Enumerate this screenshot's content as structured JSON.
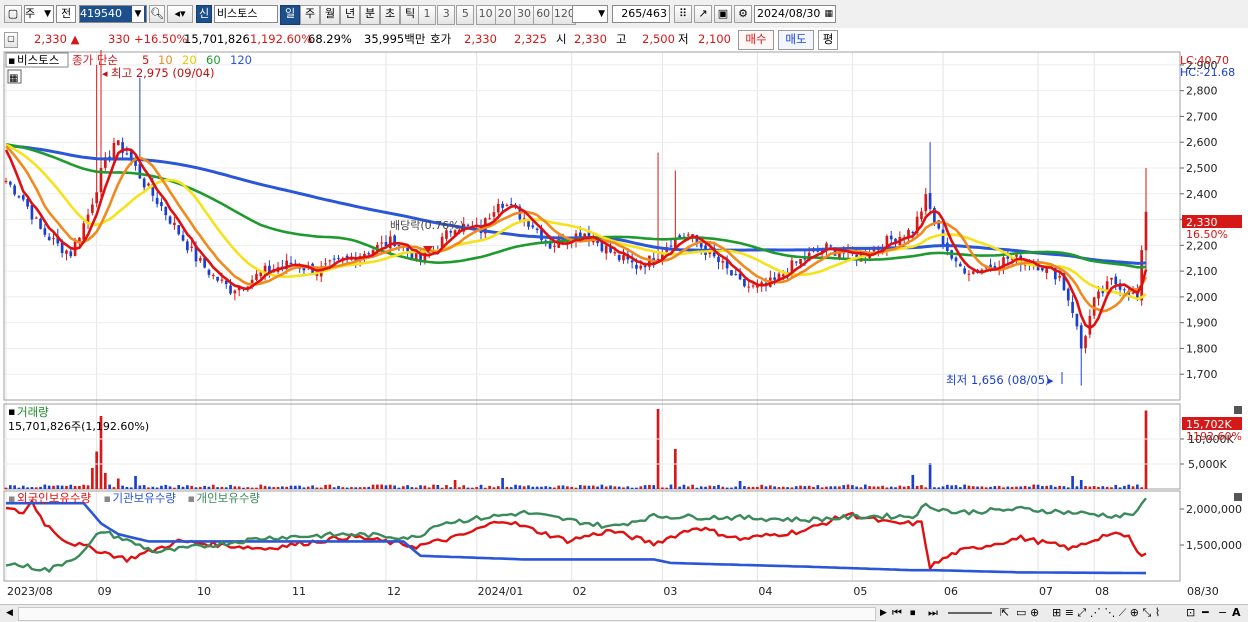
{
  "toolbar": {
    "period_type": "주",
    "prev_label": "전",
    "code": "419540",
    "badge": "신",
    "stock_name": "비스토스",
    "periods": [
      "일",
      "주",
      "월",
      "년",
      "분",
      "초",
      "틱"
    ],
    "intervals": [
      "1",
      "3",
      "5",
      "10",
      "20",
      "30",
      "60",
      "120"
    ],
    "count": "265",
    "total": "/463",
    "date": "2024/08/30"
  },
  "quote": {
    "price": "2,330",
    "change": "330",
    "change_pct": "+16.50%",
    "volume": "15,701,826",
    "volume_pct": "1,192.60%",
    "turnover": "68.29%",
    "amount": "35,995백만",
    "ask_label": "호가",
    "ask": "2,330",
    "bid": "2,325",
    "open_label": "시",
    "open": "2,330",
    "high_label": "고",
    "high": "2,500",
    "low_label": "저",
    "low": "2,100",
    "buy_label": "매수",
    "sell_label": "매도",
    "avg_label": "평"
  },
  "colors": {
    "up": "#d51818",
    "down": "#1a3fd0",
    "ma5": "#e01010",
    "ma10": "#f08a1e",
    "ma20": "#f5e21a",
    "ma60": "#1f9a2e",
    "ma120": "#2a56d8",
    "foreign": "#e01010",
    "institution": "#2a56d8",
    "individual": "#3a8a5a"
  },
  "chart_data": [
    {
      "type": "candlestick",
      "panel_title": "비스토스",
      "legend": [
        {
          "name": "종가 단순",
          "color": "#d51818"
        },
        {
          "name": "5",
          "color": "#e01010"
        },
        {
          "name": "10",
          "color": "#f08a1e"
        },
        {
          "name": "20",
          "color": "#e8c800"
        },
        {
          "name": "60",
          "color": "#1f9a2e"
        },
        {
          "name": "120",
          "color": "#2a56d8"
        }
      ],
      "y_ticks": [
        "2,900",
        "2,800",
        "2,700",
        "2,600",
        "2,500",
        "2,400",
        "2,300",
        "2,200",
        "2,100",
        "2,000",
        "1,900",
        "1,800",
        "1,700"
      ],
      "ylim": [
        1600,
        2950
      ],
      "x_ticks": [
        "2023/08",
        "09",
        "10",
        "11",
        "12",
        "2024/01",
        "02",
        "03",
        "04",
        "05",
        "06",
        "07",
        "08",
        "08/30"
      ],
      "annotations": {
        "high": "최고 2,975 (09/04)",
        "low": "최저 1,656 (08/05)",
        "dividend": "배당락(0.76%)",
        "lc": "LC:40.70",
        "hc": "HC:-21.68",
        "last_price": "2,330",
        "last_pct": "16.50%"
      },
      "keypoints": [
        {
          "t": 0,
          "v": 2450
        },
        {
          "t": 4,
          "v": 2380
        },
        {
          "t": 8,
          "v": 2260
        },
        {
          "t": 12,
          "v": 2200
        },
        {
          "t": 15,
          "v": 2170
        },
        {
          "t": 19,
          "v": 2320
        },
        {
          "t": 22,
          "v": 2480
        },
        {
          "t": 25,
          "v": 2600
        },
        {
          "t": 28,
          "v": 2560
        },
        {
          "t": 32,
          "v": 2440
        },
        {
          "t": 36,
          "v": 2350
        },
        {
          "t": 40,
          "v": 2250
        },
        {
          "t": 44,
          "v": 2150
        },
        {
          "t": 48,
          "v": 2080
        },
        {
          "t": 52,
          "v": 2030
        },
        {
          "t": 56,
          "v": 2060
        },
        {
          "t": 60,
          "v": 2100
        },
        {
          "t": 66,
          "v": 2130
        },
        {
          "t": 72,
          "v": 2100
        },
        {
          "t": 78,
          "v": 2140
        },
        {
          "t": 84,
          "v": 2180
        },
        {
          "t": 90,
          "v": 2220
        },
        {
          "t": 96,
          "v": 2140
        },
        {
          "t": 100,
          "v": 2200
        },
        {
          "t": 104,
          "v": 2280
        },
        {
          "t": 110,
          "v": 2260
        },
        {
          "t": 114,
          "v": 2380
        },
        {
          "t": 118,
          "v": 2330
        },
        {
          "t": 122,
          "v": 2280
        },
        {
          "t": 126,
          "v": 2200
        },
        {
          "t": 130,
          "v": 2230
        },
        {
          "t": 134,
          "v": 2250
        },
        {
          "t": 138,
          "v": 2200
        },
        {
          "t": 142,
          "v": 2150
        },
        {
          "t": 146,
          "v": 2120
        },
        {
          "t": 150,
          "v": 2150
        },
        {
          "t": 154,
          "v": 2220
        },
        {
          "t": 158,
          "v": 2240
        },
        {
          "t": 162,
          "v": 2180
        },
        {
          "t": 166,
          "v": 2120
        },
        {
          "t": 170,
          "v": 2050
        },
        {
          "t": 174,
          "v": 2030
        },
        {
          "t": 178,
          "v": 2060
        },
        {
          "t": 182,
          "v": 2120
        },
        {
          "t": 186,
          "v": 2160
        },
        {
          "t": 190,
          "v": 2190
        },
        {
          "t": 194,
          "v": 2170
        },
        {
          "t": 198,
          "v": 2160
        },
        {
          "t": 202,
          "v": 2200
        },
        {
          "t": 206,
          "v": 2230
        },
        {
          "t": 210,
          "v": 2260
        },
        {
          "t": 213,
          "v": 2380
        },
        {
          "t": 216,
          "v": 2250
        },
        {
          "t": 220,
          "v": 2120
        },
        {
          "t": 224,
          "v": 2100
        },
        {
          "t": 228,
          "v": 2120
        },
        {
          "t": 232,
          "v": 2150
        },
        {
          "t": 236,
          "v": 2140
        },
        {
          "t": 240,
          "v": 2120
        },
        {
          "t": 244,
          "v": 2080
        },
        {
          "t": 247,
          "v": 1950
        },
        {
          "t": 249,
          "v": 1800
        },
        {
          "t": 252,
          "v": 1980
        },
        {
          "t": 256,
          "v": 2060
        },
        {
          "t": 259,
          "v": 2040
        },
        {
          "t": 262,
          "v": 1990
        },
        {
          "t": 264,
          "v": 2330
        }
      ],
      "count": 265
    },
    {
      "type": "bar",
      "panel_title": "거래량",
      "value_label": "15,701,826주(1,192.60%)",
      "y_ticks": [
        "10,000K",
        "5,000K"
      ],
      "last_value": "15,702K",
      "last_pct": "1192.60%",
      "ylim": [
        0,
        17000
      ],
      "spikes": [
        {
          "t": 20,
          "v": 4200
        },
        {
          "t": 21,
          "v": 7500
        },
        {
          "t": 22,
          "v": 14600
        },
        {
          "t": 23,
          "v": 3200
        },
        {
          "t": 26,
          "v": 2100
        },
        {
          "t": 30,
          "v": 2600
        },
        {
          "t": 104,
          "v": 1800
        },
        {
          "t": 115,
          "v": 2200
        },
        {
          "t": 151,
          "v": 16000
        },
        {
          "t": 155,
          "v": 8000
        },
        {
          "t": 170,
          "v": 1600
        },
        {
          "t": 210,
          "v": 2800
        },
        {
          "t": 214,
          "v": 5200
        },
        {
          "t": 247,
          "v": 2600
        },
        {
          "t": 249,
          "v": 1800
        },
        {
          "t": 264,
          "v": 15702
        }
      ]
    },
    {
      "type": "line",
      "legend": [
        {
          "name": "외국인보유수량",
          "color": "#e01010"
        },
        {
          "name": "기관보유수량",
          "color": "#2a56d8"
        },
        {
          "name": "개인보유수량",
          "color": "#3a8a5a"
        }
      ],
      "y_ticks": [
        "2,000,000",
        "1,500,000"
      ],
      "ylim": [
        1000000,
        2250000
      ],
      "series": [
        {
          "name": "외국인보유수량",
          "points": [
            [
              0,
              2000000
            ],
            [
              4,
              1950000
            ],
            [
              6,
              2100000
            ],
            [
              9,
              1800000
            ],
            [
              14,
              1550000
            ],
            [
              20,
              1450000
            ],
            [
              28,
              1300000
            ],
            [
              40,
              1550000
            ],
            [
              60,
              1450000
            ],
            [
              80,
              1620000
            ],
            [
              95,
              1480000
            ],
            [
              105,
              1620000
            ],
            [
              115,
              1850000
            ],
            [
              130,
              1560000
            ],
            [
              140,
              1700000
            ],
            [
              150,
              1520000
            ],
            [
              160,
              1750000
            ],
            [
              170,
              1580000
            ],
            [
              185,
              1700000
            ],
            [
              195,
              1930000
            ],
            [
              205,
              1800000
            ],
            [
              212,
              1800000
            ],
            [
              214,
              1200000
            ],
            [
              220,
              1400000
            ],
            [
              235,
              1600000
            ],
            [
              247,
              1450000
            ],
            [
              255,
              1650000
            ],
            [
              260,
              1620000
            ],
            [
              262,
              1380000
            ],
            [
              264,
              1380000
            ]
          ]
        },
        {
          "name": "기관보유수량",
          "points": [
            [
              0,
              2080000
            ],
            [
              18,
              2080000
            ],
            [
              22,
              1800000
            ],
            [
              26,
              1650000
            ],
            [
              33,
              1550000
            ],
            [
              60,
              1550000
            ],
            [
              92,
              1550000
            ],
            [
              96,
              1350000
            ],
            [
              120,
              1300000
            ],
            [
              150,
              1300000
            ],
            [
              154,
              1250000
            ],
            [
              185,
              1200000
            ],
            [
              210,
              1150000
            ],
            [
              215,
              1150000
            ],
            [
              235,
              1120000
            ],
            [
              264,
              1110000
            ]
          ]
        },
        {
          "name": "개인보유수량",
          "points": [
            [
              0,
              1250000
            ],
            [
              10,
              1150000
            ],
            [
              18,
              1400000
            ],
            [
              22,
              1700000
            ],
            [
              35,
              1400000
            ],
            [
              60,
              1600000
            ],
            [
              80,
              1650000
            ],
            [
              95,
              1600000
            ],
            [
              100,
              1800000
            ],
            [
              120,
              1950000
            ],
            [
              140,
              1750000
            ],
            [
              150,
              1900000
            ],
            [
              170,
              1880000
            ],
            [
              185,
              1850000
            ],
            [
              200,
              1900000
            ],
            [
              210,
              1900000
            ],
            [
              213,
              2050000
            ],
            [
              220,
              1950000
            ],
            [
              235,
              2000000
            ],
            [
              247,
              1950000
            ],
            [
              258,
              1900000
            ],
            [
              262,
              1950000
            ],
            [
              264,
              2150000
            ]
          ]
        }
      ]
    }
  ]
}
